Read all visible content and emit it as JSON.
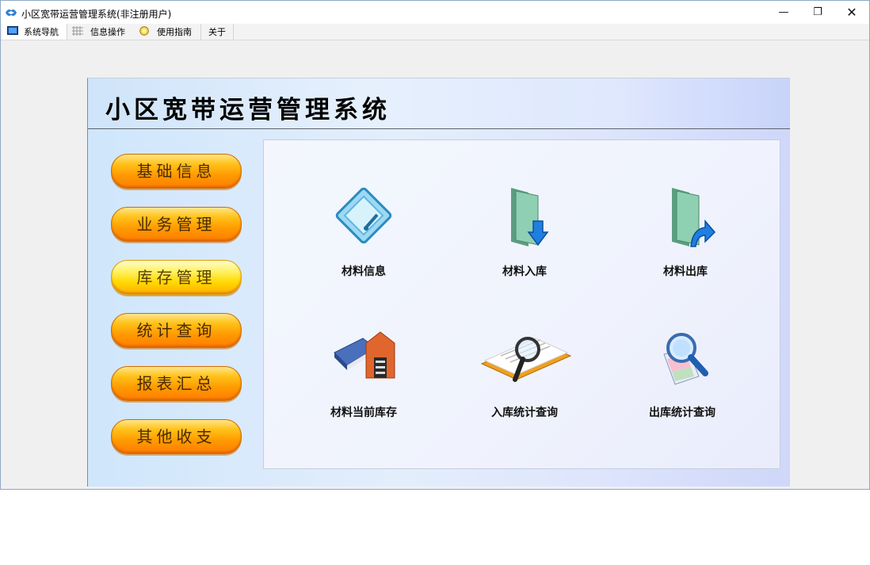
{
  "window": {
    "title": "小区宽带运营管理系统(非注册用户)",
    "minimize": "—",
    "maximize": "❐",
    "close": "✕"
  },
  "tabs": [
    {
      "label": "系统导航",
      "icon": "monitor-icon"
    },
    {
      "label": "信息操作",
      "icon": "grid-icon"
    },
    {
      "label": "使用指南",
      "icon": "help-circle-icon"
    },
    {
      "label": "关于"
    }
  ],
  "banner": {
    "title": "小区宽带运营管理系统"
  },
  "sidebar": {
    "items": [
      {
        "label": "基础信息"
      },
      {
        "label": "业务管理"
      },
      {
        "label": "库存管理"
      },
      {
        "label": "统计查询"
      },
      {
        "label": "报表汇总"
      },
      {
        "label": "其他收支"
      }
    ],
    "active_item": "库存管理"
  },
  "tiles": [
    {
      "label": "材料信息",
      "icon": "material-info-icon"
    },
    {
      "label": "材料入库",
      "icon": "folder-down-arrow-icon"
    },
    {
      "label": "材料出库",
      "icon": "folder-forward-arrow-icon"
    },
    {
      "label": "材料当前库存",
      "icon": "book-house-icon"
    },
    {
      "label": "入库统计查询",
      "icon": "magnifier-document-icon"
    },
    {
      "label": "出库统计查询",
      "icon": "search-map-icon"
    }
  ],
  "colors": {
    "button_orange": "#ff9a00",
    "button_active": "#ffe600",
    "panel_blue": "#dbe8fb"
  }
}
